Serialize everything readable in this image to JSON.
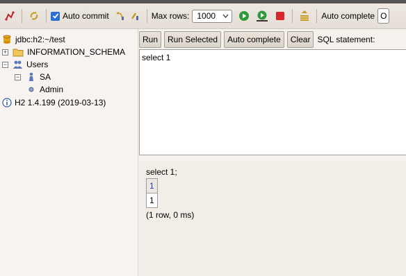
{
  "toolbar": {
    "auto_commit_label": "Auto commit",
    "max_rows_label": "Max rows:",
    "max_rows_value": "1000",
    "auto_complete_label": "Auto complete",
    "auto_complete_value": "O"
  },
  "tree": {
    "connection": "jdbc:h2:~/test",
    "schema": "INFORMATION_SCHEMA",
    "users": "Users",
    "user_sa": "SA",
    "role_admin": "Admin",
    "version": "H2 1.4.199 (2019-03-13)"
  },
  "buttons": {
    "run": "Run",
    "run_selected": "Run Selected",
    "auto_complete": "Auto complete",
    "clear": "Clear",
    "sql_statement_label": "SQL statement:"
  },
  "editor": {
    "text": "select 1"
  },
  "result": {
    "statement": "select 1;",
    "column_header": "1",
    "cell_value": "1",
    "summary": "(1 row, 0 ms)"
  }
}
